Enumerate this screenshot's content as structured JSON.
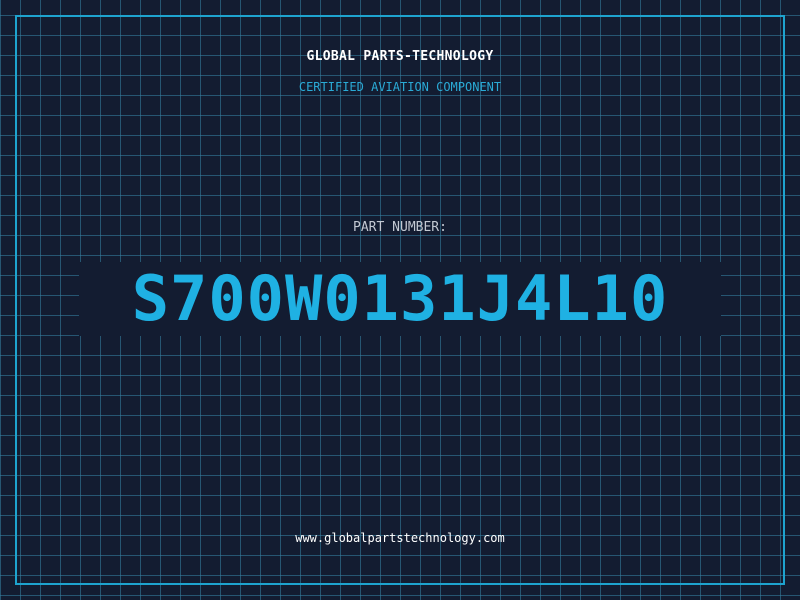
{
  "header": {
    "company": "GLOBAL PARTS-TECHNOLOGY",
    "subtitle": "CERTIFIED AVIATION COMPONENT"
  },
  "part": {
    "label": "PART NUMBER:",
    "number": "S700W0131J4L10"
  },
  "footer": {
    "url": "www.globalpartstechnology.com"
  },
  "colors": {
    "background": "#131c31",
    "grid": "#3684a8",
    "frame": "#1ea3cf",
    "accent": "#1fb1e3",
    "heading": "#ffffff",
    "label": "#c3c8d2"
  }
}
